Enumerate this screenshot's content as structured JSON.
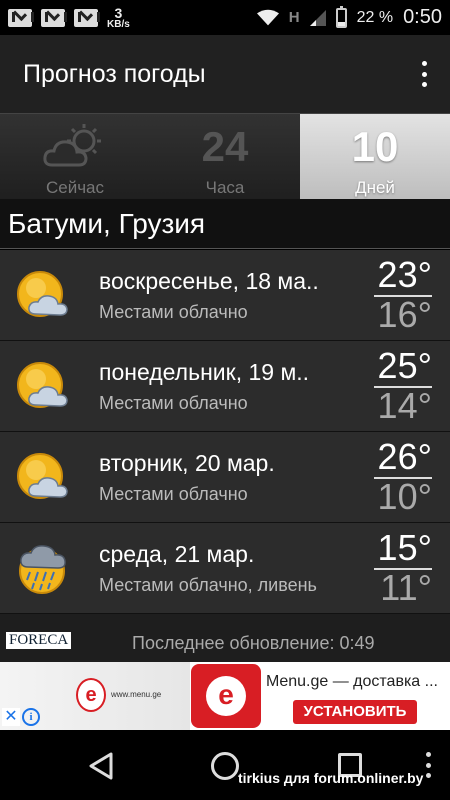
{
  "status_bar": {
    "speed_value": "3",
    "speed_unit": "KB/s",
    "network": "H",
    "battery": "22 %",
    "battery_level": 0.22,
    "time": "0:50",
    "icons": [
      "mail-icon",
      "mail-icon",
      "mail-icon",
      "wifi-icon",
      "signal-icon",
      "battery-icon"
    ]
  },
  "app_bar": {
    "title": "Прогноз погоды",
    "menu_icon": "overflow-menu-icon"
  },
  "tabs": [
    {
      "label": "Сейчас",
      "icon": "partly-cloudy-icon",
      "active": false
    },
    {
      "label": "Часа",
      "number": "24",
      "active": false
    },
    {
      "label": "Дней",
      "number": "10",
      "active": true
    }
  ],
  "location": "Батуми, Грузия",
  "forecast": [
    {
      "day": "воскресенье, 18 ма..",
      "condition": "Местами облачно",
      "high": "23°",
      "low": "16°",
      "icon": "sun-cloud-icon"
    },
    {
      "day": "понедельник, 19 м..",
      "condition": "Местами облачно",
      "high": "25°",
      "low": "14°",
      "icon": "sun-cloud-icon"
    },
    {
      "day": "вторник, 20 мар.",
      "condition": "Местами облачно",
      "high": "26°",
      "low": "10°",
      "icon": "sun-cloud-icon"
    },
    {
      "day": "среда, 21 мар.",
      "condition": "Местами облачно, ливень",
      "high": "15°",
      "low": "11°",
      "icon": "sun-rain-cloud-icon"
    }
  ],
  "footer": {
    "provider": "FORECA",
    "last_update": "Последнее обновление: 0:49"
  },
  "ad": {
    "banner_url": "www.menu.ge",
    "title": "Menu.ge — доставка ...",
    "cta": "УСТАНОВИТЬ",
    "brand_color": "#d81e24"
  },
  "nav_bar": {
    "watermark": "tirkius для forum.onliner.by"
  }
}
